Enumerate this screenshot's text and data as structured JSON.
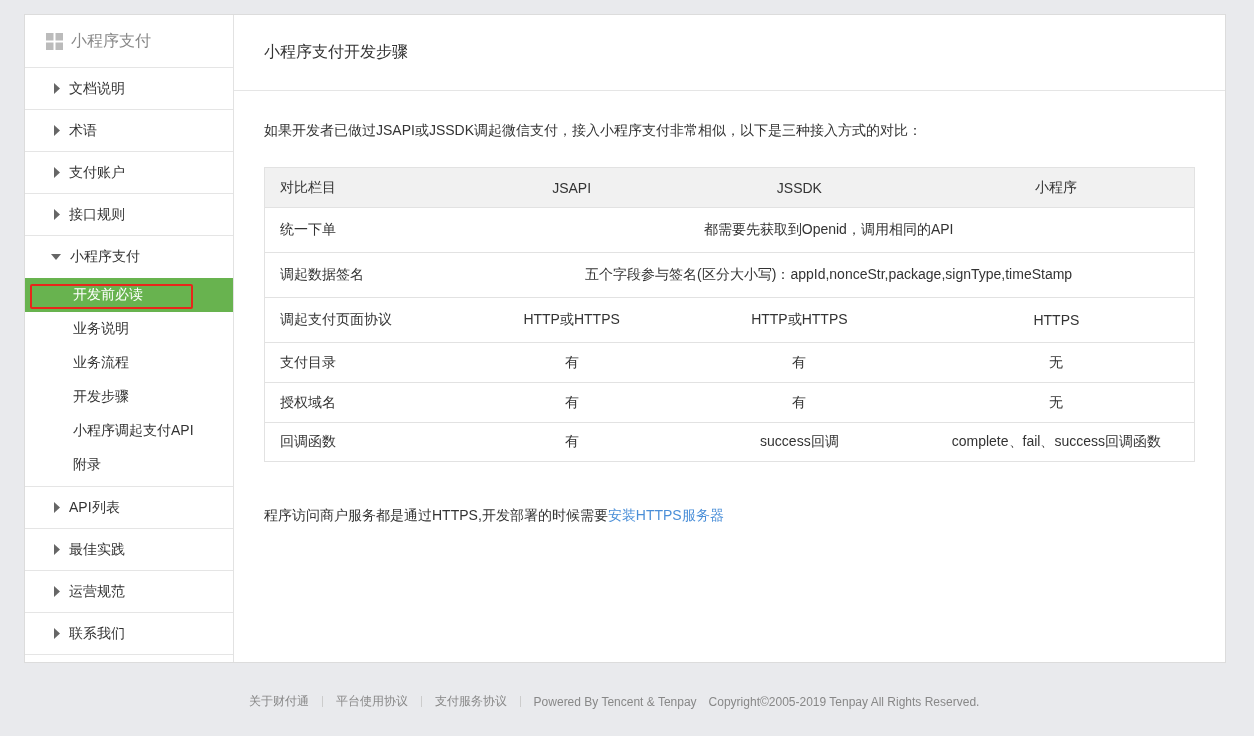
{
  "sidebar": {
    "title": "小程序支付",
    "items": [
      {
        "label": "文档说明",
        "expanded": false
      },
      {
        "label": "术语",
        "expanded": false
      },
      {
        "label": "支付账户",
        "expanded": false
      },
      {
        "label": "接口规则",
        "expanded": false
      },
      {
        "label": "小程序支付",
        "expanded": true,
        "children": [
          {
            "label": "开发前必读",
            "selected": true,
            "annotated": true
          },
          {
            "label": "业务说明",
            "selected": false,
            "annotated": false
          },
          {
            "label": "业务流程",
            "selected": false,
            "annotated": false
          },
          {
            "label": "开发步骤",
            "selected": false,
            "annotated": false
          },
          {
            "label": "小程序调起支付API",
            "selected": false,
            "annotated": false
          },
          {
            "label": "附录",
            "selected": false,
            "annotated": false
          }
        ]
      },
      {
        "label": "API列表",
        "expanded": false
      },
      {
        "label": "最佳实践",
        "expanded": false
      },
      {
        "label": "运营规范",
        "expanded": false
      },
      {
        "label": "联系我们",
        "expanded": false
      }
    ]
  },
  "main": {
    "title": "小程序支付开发步骤",
    "intro": "如果开发者已做过JSAPI或JSSDK调起微信支付，接入小程序支付非常相似，以下是三种接入方式的对比：",
    "table": {
      "columns": [
        "对比栏目",
        "JSAPI",
        "JSSDK",
        "小程序"
      ],
      "rows": [
        {
          "cells": [
            "统一下单",
            {
              "text": "都需要先获取到Openid，调用相同的API",
              "colspan": 3
            }
          ]
        },
        {
          "cells": [
            "调起数据签名",
            {
              "text": "五个字段参与签名(区分大小写)：appId,nonceStr,package,signType,timeStamp",
              "colspan": 3
            }
          ]
        },
        {
          "cells": [
            "调起支付页面协议",
            "HTTP或HTTPS",
            "HTTP或HTTPS",
            "HTTPS"
          ]
        },
        {
          "cells": [
            "支付目录",
            "有",
            "有",
            "无"
          ]
        },
        {
          "cells": [
            "授权域名",
            "有",
            "有",
            "无"
          ]
        },
        {
          "cells": [
            "回调函数",
            "有",
            "success回调",
            "complete、fail、success回调函数"
          ]
        }
      ]
    },
    "note": {
      "text": "程序访问商户服务都是通过HTTPS,开发部署的时候需要",
      "link": "安装HTTPS服务器"
    }
  },
  "footer": {
    "links": [
      "关于财付通",
      "平台使用协议",
      "支付服务协议"
    ],
    "powered": "Powered By Tencent & Tenpay",
    "copyright": "Copyright©2005-2019 Tenpay All Rights Reserved."
  }
}
